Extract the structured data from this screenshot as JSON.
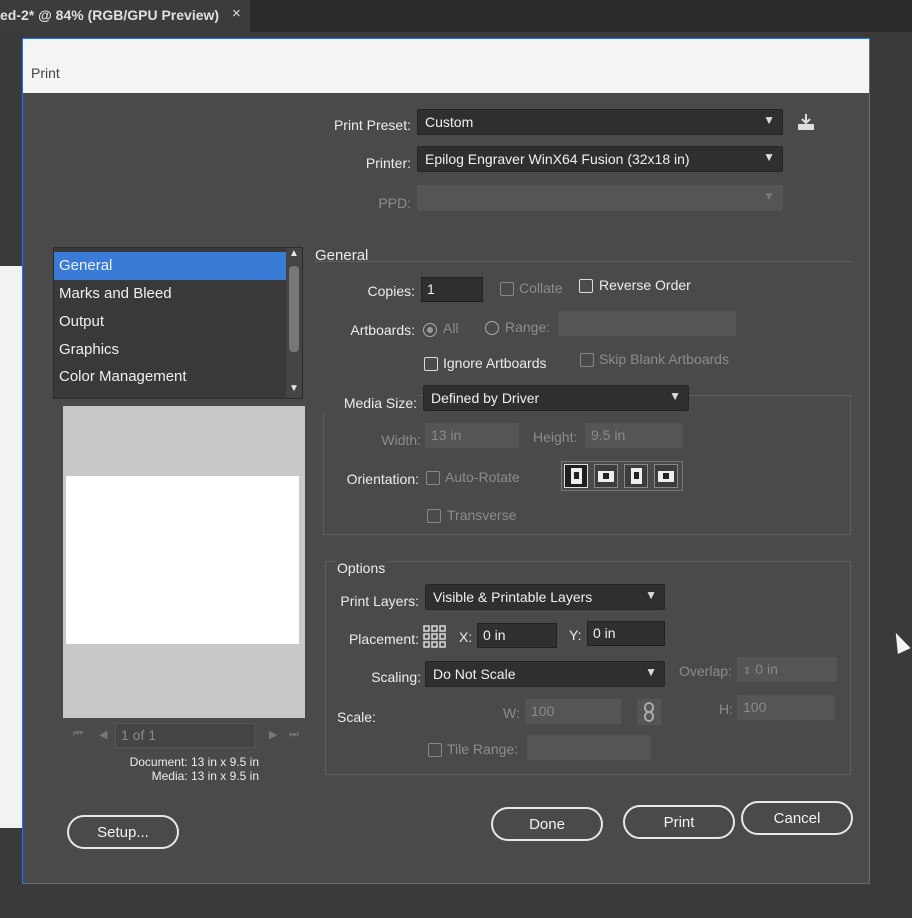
{
  "document_tab": {
    "title": "ed-2* @ 84% (RGB/GPU Preview)",
    "close": "×"
  },
  "dialog": {
    "title": "Print",
    "print_preset": {
      "label": "Print Preset:",
      "value": "Custom"
    },
    "printer": {
      "label": "Printer:",
      "value": "Epilog Engraver WinX64 Fusion (32x18 in)"
    },
    "ppd": {
      "label": "PPD:",
      "value": ""
    },
    "sidebar": {
      "items": [
        {
          "label": "General",
          "selected": true
        },
        {
          "label": "Marks and Bleed"
        },
        {
          "label": "Output"
        },
        {
          "label": "Graphics"
        },
        {
          "label": "Color Management"
        }
      ]
    },
    "preview": {
      "page_indicator": "1 of 1",
      "document_label": "Document: 13 in x 9.5 in",
      "media_label": "Media: 13 in x 9.5 in"
    },
    "general": {
      "section_title": "General",
      "copies": {
        "label": "Copies:",
        "value": "1"
      },
      "collate": "Collate",
      "reverse_order": "Reverse Order",
      "artboards": {
        "label": "Artboards:",
        "all": "All",
        "range": "Range:"
      },
      "ignore_artboards": "Ignore Artboards",
      "skip_blank": "Skip Blank Artboards",
      "media_size": {
        "label": "Media Size:",
        "value": "Defined by Driver"
      },
      "width": {
        "label": "Width:",
        "value": "13 in"
      },
      "height": {
        "label": "Height:",
        "value": "9.5 in"
      },
      "orientation": {
        "label": "Orientation:",
        "auto_rotate": "Auto-Rotate"
      },
      "transverse": "Transverse"
    },
    "options": {
      "section_title": "Options",
      "print_layers": {
        "label": "Print Layers:",
        "value": "Visible & Printable Layers"
      },
      "placement": {
        "label": "Placement:",
        "x_label": "X:",
        "x_value": "0 in",
        "y_label": "Y:",
        "y_value": "0 in"
      },
      "scaling": {
        "label": "Scaling:",
        "value": "Do Not Scale"
      },
      "overlap": {
        "label": "Overlap:",
        "value": "0 in"
      },
      "scale": {
        "label": "Scale:",
        "w_label": "W:",
        "w_value": "100",
        "h_label": "H:",
        "h_value": "100"
      },
      "tile_range": "Tile Range:"
    },
    "buttons": {
      "setup": "Setup...",
      "done": "Done",
      "print": "Print",
      "cancel": "Cancel"
    }
  }
}
